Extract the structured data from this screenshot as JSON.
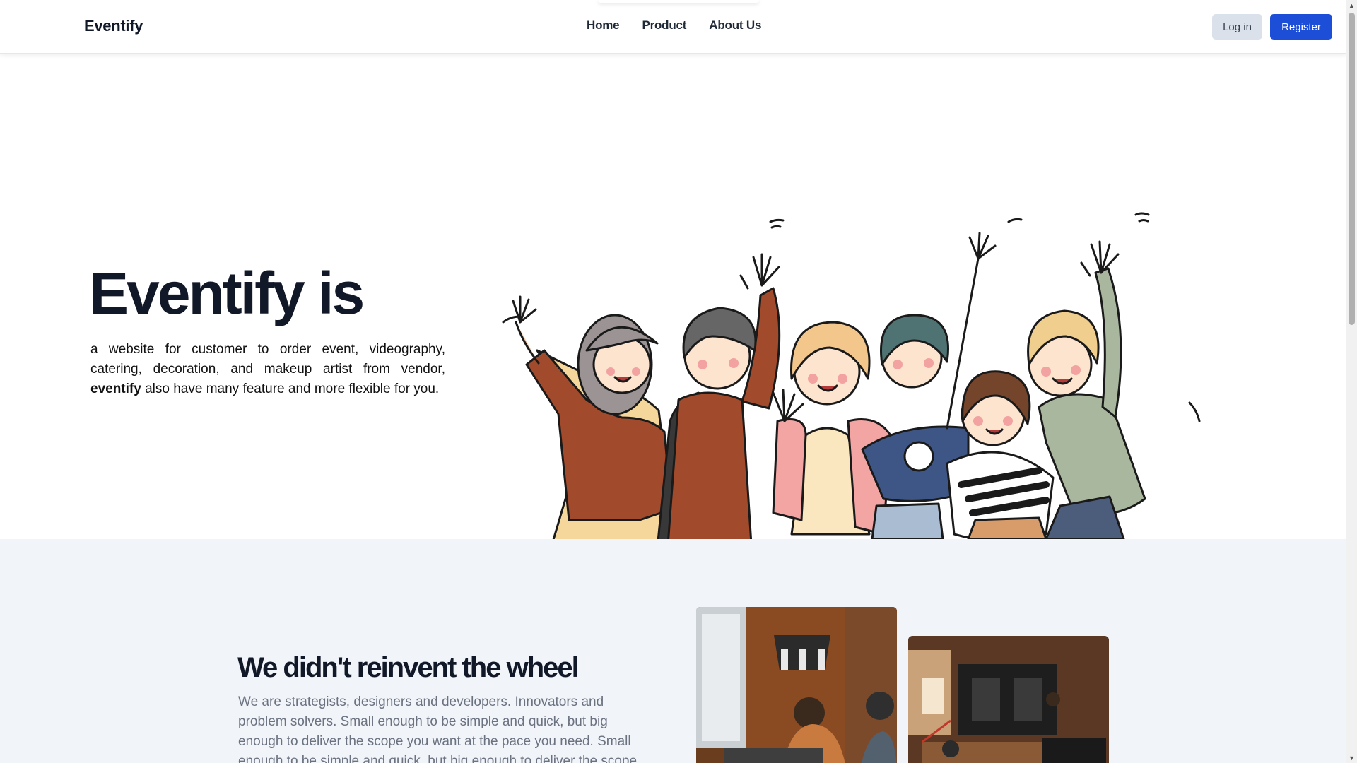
{
  "navbar": {
    "brand": "Eventify",
    "links": [
      "Home",
      "Product",
      "About Us"
    ],
    "login_label": "Log in",
    "register_label": "Register"
  },
  "hero": {
    "title": "Eventify is",
    "description": "a website for customer to order event, videography, catering, decoration, and makeup artist from vendor,",
    "description_bold": "eventify",
    "description_tail": " also have many feature and more flexible for you."
  },
  "about": {
    "title": "We didn't reinvent the wheel",
    "body": "We are strategists, designers and developers. Innovators and problem solvers. Small enough to be simple and quick, but big enough to deliver the scope you want at the pace you need. Small enough to be simple and quick, but big enough to deliver the scope"
  },
  "colors": {
    "primary": "#1d4ed8",
    "login_bg": "#dbe1ea",
    "section_bg": "#f1f4f9",
    "text_dark": "#111827",
    "text_muted": "#6b7280"
  },
  "icons": {
    "scroll_up": "triangle-up-icon",
    "scroll_down": "triangle-down-icon"
  }
}
